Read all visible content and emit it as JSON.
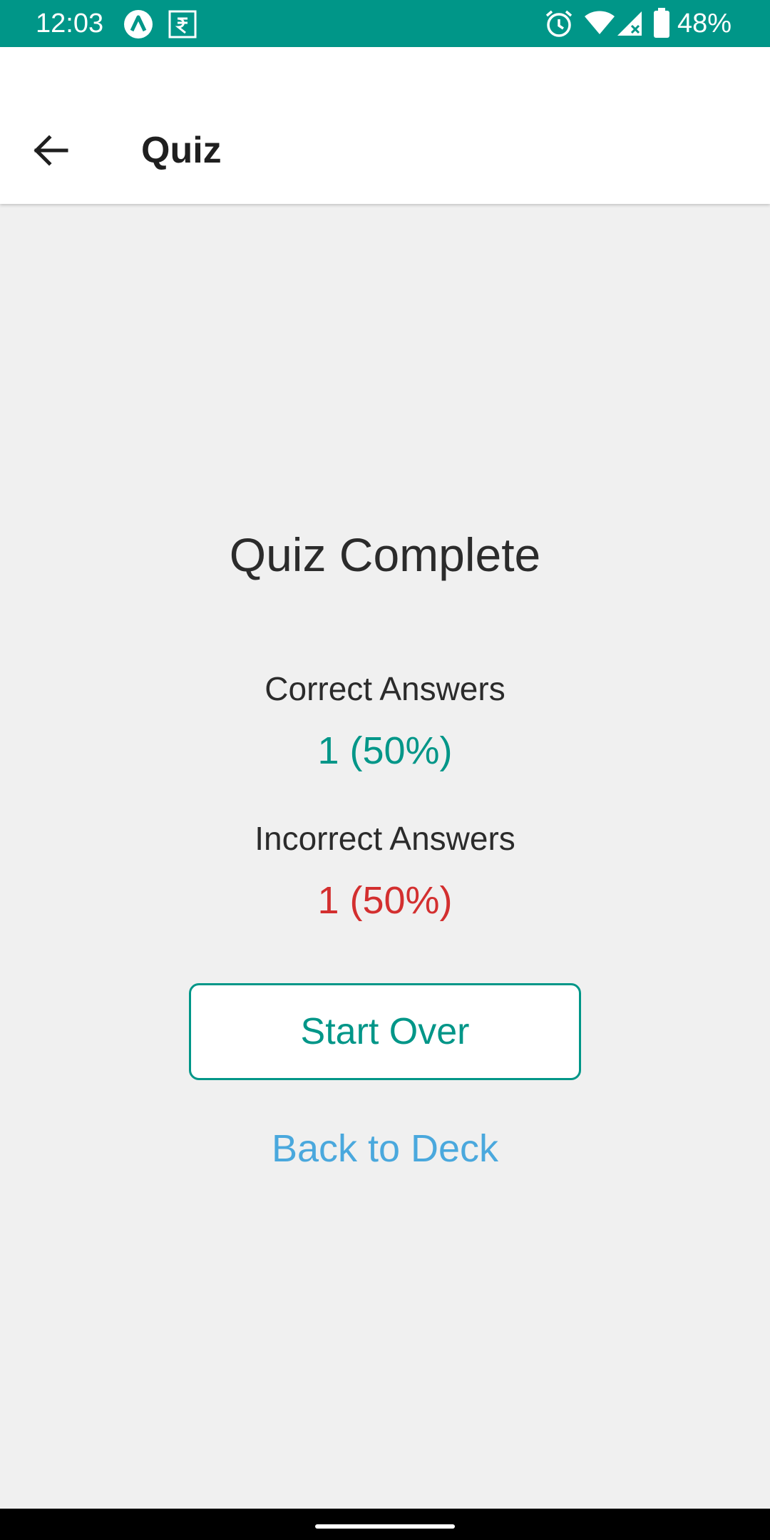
{
  "status_bar": {
    "time": "12:03",
    "battery_percent": "48%",
    "icons": [
      "app-a-icon",
      "rupee-box-icon",
      "alarm-icon",
      "wifi-icon",
      "signal-icon",
      "battery-icon"
    ],
    "color": "#009688"
  },
  "app_bar": {
    "title": "Quiz",
    "back_icon": "arrow-left-icon"
  },
  "result": {
    "heading": "Quiz Complete",
    "correct_label": "Correct Answers",
    "correct_value": "1 (50%)",
    "incorrect_label": "Incorrect Answers",
    "incorrect_value": "1 (50%)"
  },
  "actions": {
    "start_over_label": "Start Over",
    "back_to_deck_label": "Back to Deck"
  },
  "colors": {
    "accent": "#009688",
    "correct": "#009688",
    "incorrect": "#d32f2f",
    "link": "#4aa8dd",
    "background": "#f0f0f0"
  }
}
